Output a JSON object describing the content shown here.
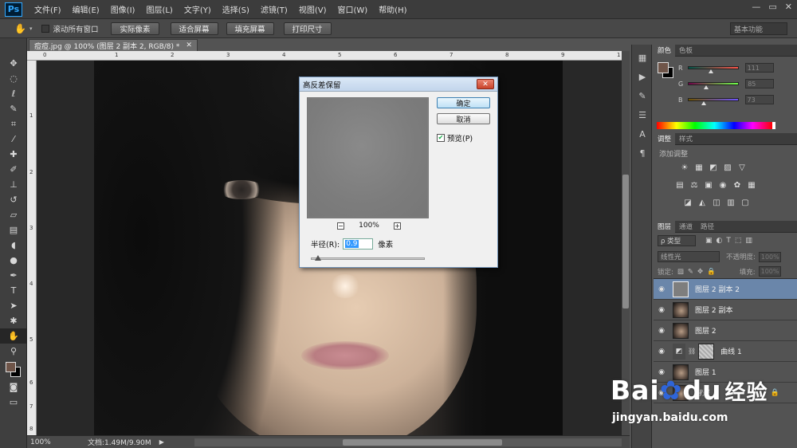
{
  "app": {
    "logo": "Ps",
    "menu": [
      "文件(F)",
      "编辑(E)",
      "图像(I)",
      "图层(L)",
      "文字(Y)",
      "选择(S)",
      "滤镜(T)",
      "视图(V)",
      "窗口(W)",
      "帮助(H)"
    ],
    "window_controls": {
      "minimize": "—",
      "maximize": "▭",
      "close": "✕"
    }
  },
  "options_bar": {
    "scroll_all_label": "滚动所有窗口",
    "buttons": [
      "实际像素",
      "适合屏幕",
      "填充屏幕",
      "打印尺寸"
    ],
    "workspace": "基本功能"
  },
  "document": {
    "tab_title": "痘痘.jpg @ 100% (图层 2 副本 2, RGB/8) *",
    "ruler_top_ticks": [
      "0",
      "1",
      "2",
      "3",
      "4",
      "5",
      "6",
      "7",
      "8",
      "9",
      "1"
    ],
    "ruler_left_ticks": [
      "1",
      "2",
      "3",
      "4",
      "5",
      "6",
      "7",
      "8"
    ],
    "status_zoom": "100%",
    "status_doc": "文档:1.49M/9.90M"
  },
  "dialog": {
    "title": "高反差保留",
    "ok_label": "确定",
    "cancel_label": "取消",
    "preview_label": "预览(P)",
    "preview_checked": true,
    "zoom_minus": "−",
    "zoom_value": "100%",
    "zoom_plus": "+",
    "radius_label": "半径(R):",
    "radius_value": "0.9",
    "radius_unit": "像素",
    "close": "✕"
  },
  "color_panel": {
    "tabs": [
      "颜色",
      "色板"
    ],
    "fg_color": "#6f5549",
    "bg_color": "#000000",
    "channels": [
      {
        "label": "R",
        "value": "111"
      },
      {
        "label": "G",
        "value": "85"
      },
      {
        "label": "B",
        "value": "73"
      }
    ]
  },
  "adjustments_panel": {
    "tabs": [
      "调整",
      "样式"
    ],
    "add_label": "添加调整",
    "row1": [
      "☀",
      "▦",
      "◩",
      "▨",
      "▽"
    ],
    "row2": [
      "▤",
      "⚖",
      "▣",
      "◉",
      "✿",
      "▦"
    ],
    "row3": [
      "◪",
      "◭",
      "◫",
      "▥",
      "▢"
    ]
  },
  "layers_panel": {
    "tabs": [
      "图层",
      "通道",
      "路径"
    ],
    "kind_label": "ρ 类型",
    "filter_icons": [
      "▣",
      "◐",
      "T",
      "⬚",
      "▥"
    ],
    "blend_mode": "线性光",
    "opacity_label": "不透明度:",
    "opacity_value": "100%",
    "lock_label": "锁定:",
    "lock_icons": [
      "▨",
      "✎",
      "✥",
      "🔒"
    ],
    "fill_label": "填充:",
    "fill_value": "100%",
    "layers": [
      {
        "name": "图层 2 副本 2",
        "selected": true
      },
      {
        "name": "图层 2 副本",
        "selected": false
      },
      {
        "name": "图层 2",
        "selected": false
      },
      {
        "name": "曲线 1",
        "selected": false
      },
      {
        "name": "图层 1",
        "selected": false
      },
      {
        "name": "背景",
        "selected": false
      }
    ],
    "bottom_icons": [
      "∞",
      "fx",
      "◙",
      "◎",
      "▭",
      "▤",
      "🗑"
    ]
  },
  "watermark": {
    "logo_bai": "Bai",
    "logo_du": "du",
    "logo_jy": "经验",
    "url": "jingyan.baidu.com"
  }
}
